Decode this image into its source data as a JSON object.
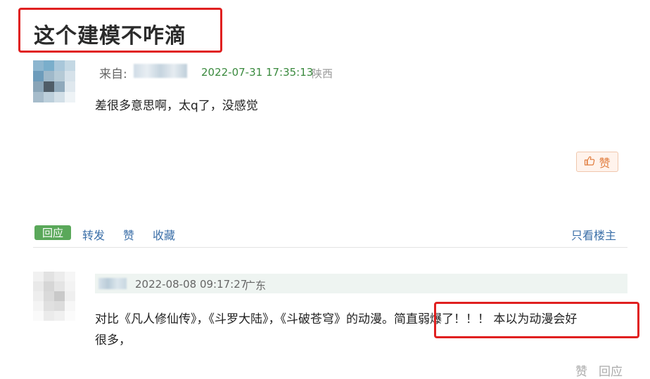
{
  "post": {
    "title": "这个建模不咋滴",
    "from_label": "来自:",
    "datetime": "2022-07-31 17:35:13",
    "location": "陕西",
    "content": "差很多意思啊，太q了，没感觉",
    "like_label": "赞",
    "avatar_colors": [
      "#8db6cf",
      "#7aaecb",
      "#a9c7da",
      "#c4d8e4",
      "#6d9cbb",
      "#9fb9ca",
      "#b5cad6",
      "#d6e2ea",
      "#8aa5b8",
      "#4f5d68",
      "#8fa9bb",
      "#dfe8ee",
      "#a6bccb",
      "#bccfdb",
      "#d2dfe7",
      "#eef3f6"
    ]
  },
  "actions": {
    "reply": "回应",
    "forward": "转发",
    "like": "赞",
    "favorite": "收藏",
    "op_only": "只看楼主"
  },
  "reply": {
    "datetime": "2022-08-08 09:17:27",
    "location": "广东",
    "line1_part1": "对比《凡人修仙传》，《斗罗大陆》，《斗破苍穹》的动漫。",
    "line1_part2": "简直弱爆了！！！ 本以为动漫会好",
    "line2": "很多，",
    "like_label": "赞",
    "reply_label": "回应",
    "avatar_colors": [
      "#f1f1f1",
      "#e2e2e2",
      "#ececec",
      "#f6f6f6",
      "#e9e9e9",
      "#d6d6d6",
      "#e4e4e4",
      "#f3f3f3",
      "#eeeeee",
      "#dadada",
      "#c9c9c9",
      "#efefef",
      "#f4f4f4",
      "#e0e0e0",
      "#dcdcdc",
      "#f7f7f7",
      "#fafafa",
      "#ebebeb",
      "#f0f0f0",
      "#fbfbfb"
    ]
  },
  "colors": {
    "highlight": "#e02020",
    "date_green": "#3a8a3e",
    "link_blue": "#3b6fa8",
    "reply_tab_green": "#5aa85a"
  }
}
